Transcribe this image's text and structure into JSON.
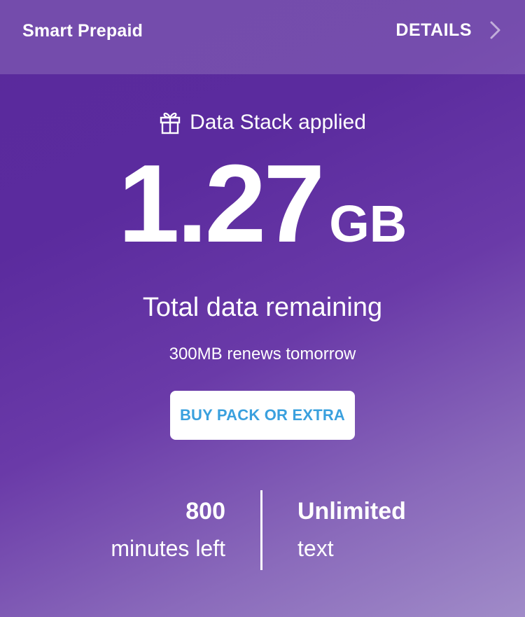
{
  "header": {
    "brand": "Smart Prepaid",
    "details_label": "DETAILS"
  },
  "balance": {
    "stack_label": "Data Stack applied",
    "amount": "1.27",
    "unit": "GB",
    "caption": "Total data remaining",
    "renew_note": "300MB renews tomorrow"
  },
  "actions": {
    "buy_label": "BUY PACK OR EXTRA"
  },
  "stats": {
    "minutes": {
      "value": "800",
      "label": "minutes left"
    },
    "text": {
      "value": "Unlimited",
      "label": "text"
    }
  },
  "icons": {
    "gift": "gift-icon",
    "chevron": "chevron-right-icon"
  },
  "colors": {
    "background_start": "#5a2a9c",
    "background_end": "#a08bc8",
    "button_text": "#3aa0de",
    "text": "#ffffff"
  }
}
